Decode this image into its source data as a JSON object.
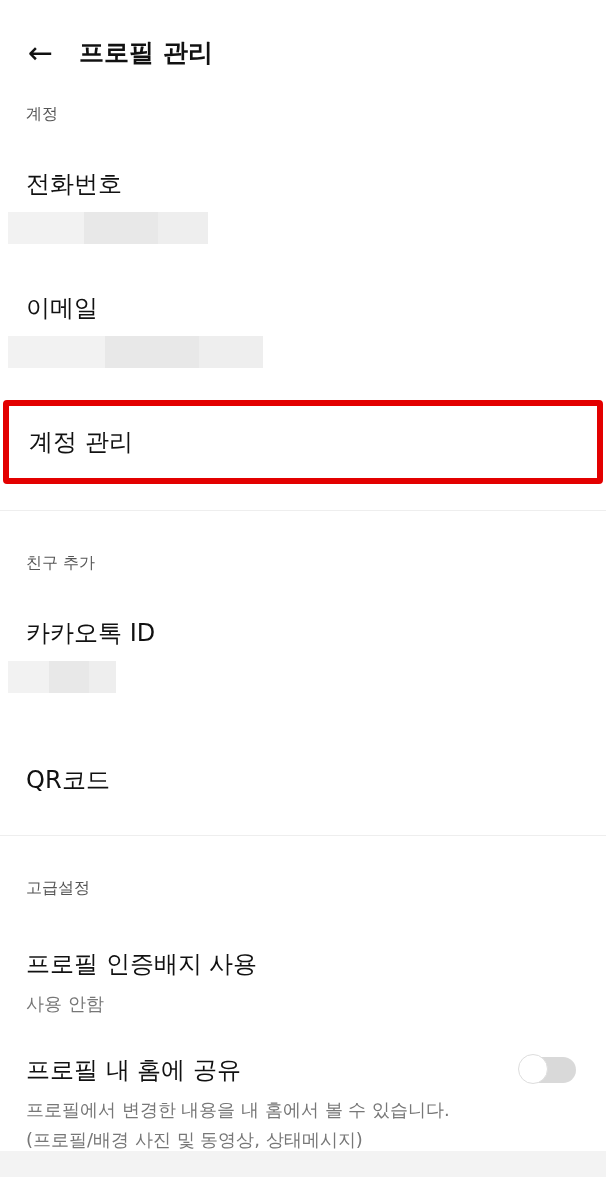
{
  "header": {
    "back": "←",
    "title": "프로필 관리"
  },
  "sections": [
    {
      "label": "계정",
      "items": [
        {
          "kind": "redacted",
          "title": "전화번호",
          "highlighted": false
        },
        {
          "kind": "redacted",
          "title": "이메일",
          "highlighted": false
        },
        {
          "kind": "plain",
          "title": "계정 관리",
          "highlighted": true
        }
      ]
    },
    {
      "label": "친구 추가",
      "items": [
        {
          "kind": "redacted",
          "title": "카카오톡 ID",
          "highlighted": false
        },
        {
          "kind": "plain",
          "title": "QR코드",
          "highlighted": false
        }
      ]
    },
    {
      "label": "고급설정",
      "items": [
        {
          "kind": "value",
          "title": "프로필 인증배지 사용",
          "value": "사용 안함",
          "highlighted": false
        },
        {
          "kind": "toggle",
          "title": "프로필 내 홈에 공유",
          "on": false,
          "description": "프로필에서 변경한 내용을 내 홈에서 볼 수 있습니다.",
          "note": "(프로필/배경 사진 및 동영상, 상태메시지)",
          "highlighted": false
        }
      ]
    }
  ]
}
